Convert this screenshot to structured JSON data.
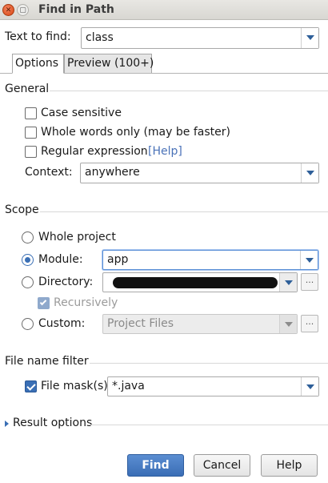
{
  "window": {
    "title": "Find in Path"
  },
  "search": {
    "label": "Text to find:",
    "value": "class"
  },
  "tabs": [
    {
      "label": "Options",
      "active": true
    },
    {
      "label": "Preview (100+)",
      "active": false
    }
  ],
  "general": {
    "header": "General",
    "case_sensitive": {
      "label": "Case sensitive",
      "checked": false
    },
    "whole_words": {
      "label": "Whole words only (may be faster)",
      "checked": false
    },
    "regex": {
      "label": "Regular expression",
      "help": "[Help]",
      "checked": false
    },
    "context": {
      "label": "Context:",
      "value": "anywhere"
    }
  },
  "scope": {
    "header": "Scope",
    "whole_project": {
      "label": "Whole project",
      "selected": false
    },
    "module": {
      "label": "Module:",
      "value": "app",
      "selected": true
    },
    "directory": {
      "label": "Directory:",
      "value": "",
      "selected": false,
      "browse": "..."
    },
    "recursively": {
      "label": "Recursively",
      "checked": true
    },
    "custom": {
      "label": "Custom:",
      "value": "Project Files",
      "selected": false,
      "browse": "..."
    }
  },
  "filter": {
    "header": "File name filter",
    "file_mask": {
      "label": "File mask(s)",
      "value": "*.java",
      "checked": true
    }
  },
  "result_options": {
    "label": "Result options"
  },
  "buttons": {
    "find": "Find",
    "cancel": "Cancel",
    "help": "Help"
  },
  "colors": {
    "accent": "#3a6fb5",
    "link": "#4a72b8",
    "close": "#e0531b"
  }
}
